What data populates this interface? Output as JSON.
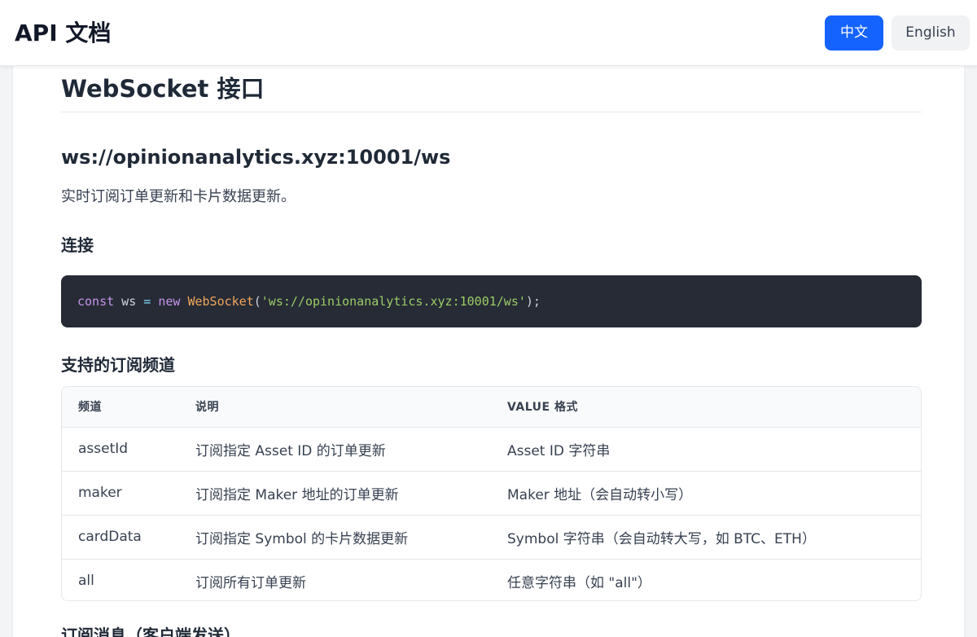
{
  "header": {
    "title": "API 文档",
    "lang_zh": "中文",
    "lang_en": "English"
  },
  "section": {
    "title": "WebSocket 接口",
    "endpoint": "ws://opinionanalytics.xyz:10001/ws",
    "description": "实时订阅订单更新和卡片数据更新。",
    "connect_heading": "连接",
    "code": {
      "keyword_const": "const",
      "var_name": " ws ",
      "op_eq": "=",
      "space": " ",
      "keyword_new": "new",
      "class_name": "WebSocket",
      "paren_open": "(",
      "string": "'ws://opinionanalytics.xyz:10001/ws'",
      "paren_close": ");"
    },
    "channels_heading": "支持的订阅频道",
    "subscribe_heading": "订阅消息（客户端发送）"
  },
  "table": {
    "headers": [
      "频道",
      "说明",
      "VALUE 格式"
    ],
    "rows": [
      [
        "assetId",
        "订阅指定 Asset ID 的订单更新",
        "Asset ID 字符串"
      ],
      [
        "maker",
        "订阅指定 Maker 地址的订单更新",
        "Maker 地址（会自动转小写）"
      ],
      [
        "cardData",
        "订阅指定 Symbol 的卡片数据更新",
        "Symbol 字符串（会自动转大写，如 BTC、ETH）"
      ],
      [
        "all",
        "订阅所有订单更新",
        "任意字符串（如 \"all\"）"
      ]
    ]
  },
  "colors": {
    "primary_button": "#1463ff",
    "code_background": "#262b36"
  }
}
